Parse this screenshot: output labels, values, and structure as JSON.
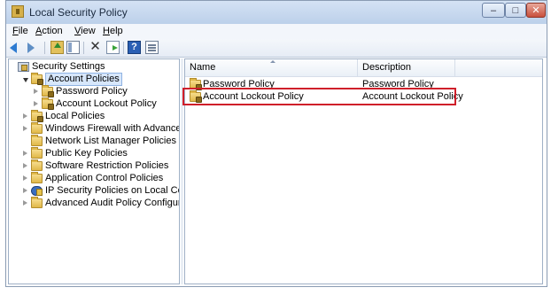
{
  "window": {
    "title": "Local Security Policy",
    "controls": {
      "minimize": "–",
      "maximize": "□",
      "close": "✕"
    }
  },
  "menu": [
    {
      "mnemonic": "F",
      "rest": "ile"
    },
    {
      "mnemonic": "A",
      "rest": "ction"
    },
    {
      "mnemonic": "V",
      "rest": "iew"
    },
    {
      "mnemonic": "H",
      "rest": "elp"
    }
  ],
  "toolbar": {
    "icons": [
      "back-arrow-icon",
      "forward-arrow-icon",
      "up-folder-icon",
      "show-hide-tree-icon",
      "delete-icon",
      "export-list-icon",
      "help-icon",
      "properties-icon"
    ],
    "delete_glyph": "✕",
    "help_glyph": "?"
  },
  "tree": {
    "items": [
      {
        "label": "Security Settings",
        "indent": 0,
        "expander": "none",
        "icon": "settings-icon",
        "selected": false
      },
      {
        "label": "Account Policies",
        "indent": 1,
        "expander": "open",
        "icon": "folder-lock-icon",
        "selected": true
      },
      {
        "label": "Password Policy",
        "indent": 2,
        "expander": "closed",
        "icon": "folder-lock-icon",
        "selected": false
      },
      {
        "label": "Account Lockout Policy",
        "indent": 2,
        "expander": "closed",
        "icon": "folder-lock-icon",
        "selected": false
      },
      {
        "label": "Local Policies",
        "indent": 1,
        "expander": "closed",
        "icon": "folder-lock-icon",
        "selected": false
      },
      {
        "label": "Windows Firewall with Advanced Secu",
        "indent": 1,
        "expander": "closed",
        "icon": "folder-icon",
        "selected": false
      },
      {
        "label": "Network List Manager Policies",
        "indent": 1,
        "expander": "none",
        "icon": "folder-icon",
        "selected": false
      },
      {
        "label": "Public Key Policies",
        "indent": 1,
        "expander": "closed",
        "icon": "folder-icon",
        "selected": false
      },
      {
        "label": "Software Restriction Policies",
        "indent": 1,
        "expander": "closed",
        "icon": "folder-icon",
        "selected": false
      },
      {
        "label": "Application Control Policies",
        "indent": 1,
        "expander": "closed",
        "icon": "folder-icon",
        "selected": false
      },
      {
        "label": "IP Security Policies on Local Compute",
        "indent": 1,
        "expander": "closed",
        "icon": "ip-security-icon",
        "selected": false
      },
      {
        "label": "Advanced Audit Policy Configuration",
        "indent": 1,
        "expander": "closed",
        "icon": "folder-icon",
        "selected": false
      }
    ]
  },
  "list": {
    "columns": [
      "Name",
      "Description"
    ],
    "rows": [
      {
        "name": "Password Policy",
        "description": "Password Policy",
        "icon": "folder-lock-icon",
        "highlighted": false
      },
      {
        "name": "Account Lockout Policy",
        "description": "Account Lockout Policy",
        "icon": "folder-lock-icon",
        "highlighted": true
      }
    ]
  },
  "colors": {
    "highlight_border": "#cf1f2a",
    "selection_fill": "#d7e7fb",
    "folder": "#e0b848"
  }
}
